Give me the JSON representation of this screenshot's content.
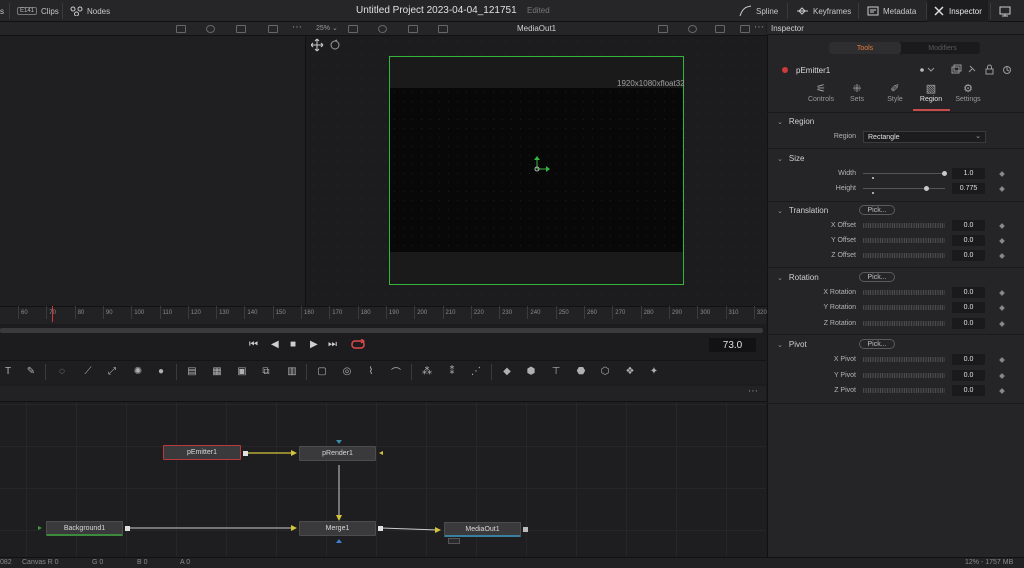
{
  "topbar": {
    "left_stub": "s",
    "clips_badge": "E141",
    "clips": "Clips",
    "nodes": "Nodes",
    "title": "Untitled Project 2023-04-04_121751",
    "status": "Edited",
    "spline": "Spline",
    "keyframes": "Keyframes",
    "metadata": "Metadata",
    "inspector": "Inspector"
  },
  "viewer": {
    "zoom": "25%",
    "name": "MediaOut1",
    "resolution": "1920x1080xfloat32"
  },
  "timeline": {
    "ticks": [
      "60",
      "70",
      "80",
      "90",
      "100",
      "110",
      "120",
      "130",
      "140",
      "150",
      "160",
      "170",
      "180",
      "190",
      "200",
      "210",
      "220",
      "230",
      "240",
      "250",
      "260",
      "270",
      "280",
      "290",
      "300",
      "310",
      "320"
    ],
    "timecode": "73.0"
  },
  "nodes": {
    "pemitter": "pEmitter1",
    "prender": "pRender1",
    "background": "Background1",
    "merge": "Merge1",
    "mediaout": "MediaOut1"
  },
  "statusbar": {
    "left_num": "082",
    "canvas": "Canvas R 0",
    "g": "G 0",
    "b": "B 0",
    "a": "A 0",
    "memory": "12% - 1757 MB"
  },
  "inspector": {
    "title": "Inspector",
    "tab_tools": "Tools",
    "tab_modifiers": "Modifiers",
    "node_name": "pEmitter1",
    "subtabs": {
      "controls": "Controls",
      "sets": "Sets",
      "style": "Style",
      "region": "Region",
      "settings": "Settings"
    },
    "region": {
      "header": "Region",
      "label": "Region",
      "value": "Rectangle"
    },
    "size": {
      "header": "Size",
      "width_label": "Width",
      "width_value": "1.0",
      "width_fraction": 1.0,
      "height_label": "Height",
      "height_value": "0.775",
      "height_fraction": 0.775
    },
    "translation": {
      "header": "Translation",
      "pick": "Pick...",
      "x_label": "X Offset",
      "x_value": "0.0",
      "y_label": "Y Offset",
      "y_value": "0.0",
      "z_label": "Z Offset",
      "z_value": "0.0"
    },
    "rotation": {
      "header": "Rotation",
      "pick": "Pick...",
      "x_label": "X Rotation",
      "x_value": "0.0",
      "y_label": "Y Rotation",
      "y_value": "0.0",
      "z_label": "Z Rotation",
      "z_value": "0.0"
    },
    "pivot": {
      "header": "Pivot",
      "pick": "Pick...",
      "x_label": "X Pivot",
      "x_value": "0.0",
      "y_label": "Y Pivot",
      "y_value": "0.0",
      "z_label": "Z Pivot",
      "z_value": "0.0"
    }
  },
  "colors": {
    "accent_orange": "#e07a3a",
    "viewer_frame_green": "#34b43c",
    "selected_red": "#cc3b3b",
    "connection_yellow": "#d4c43a"
  },
  "icons": {
    "transport": [
      "skip-to-start-icon",
      "step-back-icon",
      "stop-icon",
      "play-icon",
      "skip-to-end-icon",
      "loop-icon"
    ]
  }
}
